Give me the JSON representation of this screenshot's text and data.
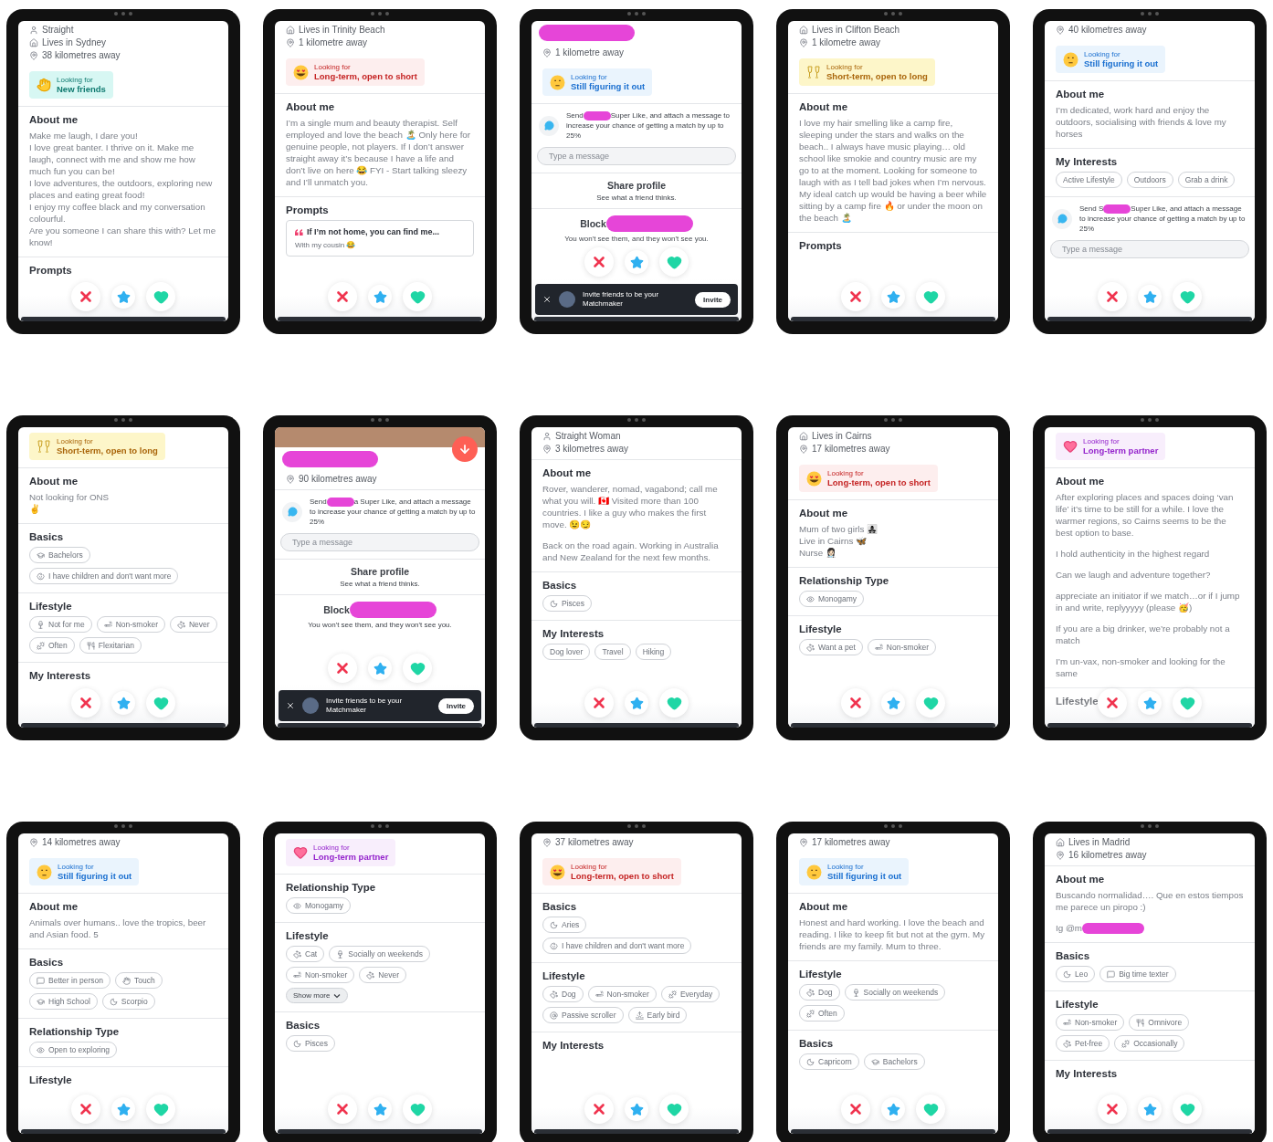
{
  "tablets": [
    {
      "blocks": [
        {
          "kind": "meta",
          "items": [
            {
              "kind": "orientation",
              "text": "Straight"
            },
            {
              "kind": "residence",
              "text": "Lives in Sydney"
            },
            {
              "kind": "distance",
              "text": "38 kilometres away"
            }
          ]
        },
        {
          "kind": "looking",
          "color": "#0f7a70",
          "label": "Looking for",
          "value": "New friends"
        },
        {
          "kind": "section",
          "title": "About me",
          "paragraphs": [
            {
              "text": "Make me laugh, I dare you!\nI love great banter. I thrive on it. Make me laugh, connect with me and show me how much fun you can be!\nI love adventures, the outdoors, exploring new places and eating great food!\nI enjoy my coffee black and my conversation colourful.\nAre you someone I can share this with? Let me know!",
              "redacted": false
            }
          ]
        },
        {
          "kind": "section",
          "title": "Prompts"
        }
      ]
    },
    {
      "blocks": [
        {
          "kind": "meta",
          "items": [
            {
              "kind": "residence",
              "text": "Lives in Trinity Beach"
            },
            {
              "kind": "distance",
              "text": "1 kilometre away"
            }
          ]
        },
        {
          "kind": "looking",
          "color": "#c52424",
          "label": "Looking for",
          "value": "Long-term, open to short"
        },
        {
          "kind": "section",
          "title": "About me",
          "paragraphs": [
            {
              "text": "I’m a single mum and beauty therapist. Self employed and love the beach 🏝️ Only here for genuine people, not players. If I don’t answer straight away it’s because I have a life and don’t live on here 😂 FYI - Start talking sleezy and I’ll unmatch you.",
              "redacted": false
            }
          ]
        },
        {
          "kind": "section",
          "title": "Prompts",
          "prompts": [
            {
              "question": "If I’m not home, you can find me...",
              "answer": "With my cousin 😂"
            }
          ]
        }
      ]
    },
    {
      "blocks": [
        {
          "kind": "hidden_name"
        },
        {
          "kind": "meta",
          "items": [
            {
              "kind": "distance",
              "text": "1 kilometre away"
            }
          ]
        },
        {
          "kind": "looking",
          "color": "#1a6fd0",
          "label": "Looking for",
          "value": "Still figuring it out"
        },
        {
          "kind": "superlike",
          "before": "Send",
          "after": "Super Like, and attach a message to increase your chance of getting a match by up to 25%"
        },
        {
          "kind": "message",
          "placeholder": "Type a message"
        },
        {
          "kind": "share",
          "title": "Share profile",
          "subtitle": "See what a friend thinks."
        },
        {
          "kind": "block",
          "title": "Block",
          "subtitle": "You won't see them, and they won't see you."
        }
      ],
      "invite": {
        "text": "Invite friends to be your Matchmaker",
        "button": "Invite"
      }
    },
    {
      "blocks": [
        {
          "kind": "meta",
          "items": [
            {
              "kind": "residence",
              "text": "Lives in Clifton Beach"
            },
            {
              "kind": "distance",
              "text": "1 kilometre away"
            }
          ]
        },
        {
          "kind": "looking",
          "color": "#a9650a",
          "label": "Looking for",
          "value": "Short-term, open to long"
        },
        {
          "kind": "section",
          "title": "About me",
          "paragraphs": [
            {
              "text": "I love my hair smelling like a camp fire, sleeping under the stars and walks on the beach.. I always have music playing… old school like smokie and country music are my go to at the moment. Looking for someone to laugh with as I tell bad jokes when I’m nervous. My ideal catch up would be having a beer while sitting by a camp fire 🔥 or under the moon on the beach 🏝️",
              "redacted": false
            }
          ]
        },
        {
          "kind": "section",
          "title": "Prompts"
        }
      ]
    },
    {
      "blocks": [
        {
          "kind": "meta",
          "items": [
            {
              "kind": "distance",
              "text": "40 kilometres away"
            }
          ]
        },
        {
          "kind": "looking",
          "color": "#1a6fd0",
          "label": "Looking for",
          "value": "Still figuring it out"
        },
        {
          "kind": "section",
          "title": "About me",
          "paragraphs": [
            {
              "text": "I’m dedicated, work hard and enjoy the outdoors, socialising with friends & love my horses",
              "redacted": false
            }
          ]
        },
        {
          "kind": "section",
          "title": "My Interests",
          "chips": [
            {
              "kind": "interest",
              "label": "Active Lifestyle"
            },
            {
              "kind": "interest",
              "label": "Outdoors"
            },
            {
              "kind": "interest",
              "label": "Grab a drink"
            }
          ]
        },
        {
          "kind": "superlike",
          "before": "Send S",
          "after": "Super Like, and attach a message to increase your chance of getting a match by up to 25%"
        },
        {
          "kind": "message",
          "placeholder": "Type a message"
        }
      ]
    },
    {
      "blocks": [
        {
          "kind": "looking",
          "color": "#a9650a",
          "label": "Looking for",
          "value": "Short-term, open to long"
        },
        {
          "kind": "section",
          "title": "About me",
          "paragraphs": [
            {
              "text": "Not looking for ONS\n✌️",
              "redacted": false
            }
          ]
        },
        {
          "kind": "section",
          "title": "Basics",
          "chips": [
            {
              "kind": "education",
              "label": "Bachelors"
            },
            {
              "kind": "family",
              "label": "I have children and don't want more"
            }
          ]
        },
        {
          "kind": "section",
          "title": "Lifestyle",
          "chips": [
            {
              "kind": "drinking",
              "label": "Not for me"
            },
            {
              "kind": "smoking",
              "label": "Non-smoker"
            },
            {
              "kind": "pets",
              "label": "Never"
            },
            {
              "kind": "workout",
              "label": "Often"
            },
            {
              "kind": "diet",
              "label": "Flexitarian"
            }
          ]
        },
        {
          "kind": "section",
          "title": "My Interests"
        }
      ]
    },
    {
      "blocks": [
        {
          "kind": "photo"
        },
        {
          "kind": "hidden_name"
        },
        {
          "kind": "meta",
          "items": [
            {
              "kind": "distance",
              "text": "90 kilometres away"
            }
          ]
        },
        {
          "kind": "superlike",
          "before": "Send",
          "after": "a Super Like, and attach a message to increase your chance of getting a match by up to 25%"
        },
        {
          "kind": "message",
          "placeholder": "Type a message"
        },
        {
          "kind": "share",
          "title": "Share profile",
          "subtitle": "See what a friend thinks."
        },
        {
          "kind": "block",
          "title": "Block",
          "subtitle": "You won't see them, and they won't see you."
        }
      ],
      "invite": {
        "text": "Invite friends to be your Matchmaker",
        "button": "Invite"
      }
    },
    {
      "blocks": [
        {
          "kind": "meta",
          "items": [
            {
              "kind": "orientation",
              "text": "Straight Woman"
            },
            {
              "kind": "distance",
              "text": "3 kilometres away"
            }
          ]
        },
        {
          "kind": "section",
          "title": "About me",
          "paragraphs": [
            {
              "text": "Rover, wanderer, nomad, vagabond; call me what you will. 🇨🇦 Visited more than 100 countries.  I like a guy who makes the first move. 😉😏",
              "redacted": false
            },
            {
              "text": "Back on the road again.  Working in Australia and New Zealand for the next few months.",
              "redacted": false
            }
          ]
        },
        {
          "kind": "section",
          "title": "Basics",
          "chips": [
            {
              "kind": "zodiac",
              "label": "Pisces"
            }
          ]
        },
        {
          "kind": "section",
          "title": "My Interests",
          "chips": [
            {
              "kind": "interest",
              "label": "Dog lover"
            },
            {
              "kind": "interest",
              "label": "Travel"
            },
            {
              "kind": "interest",
              "label": "Hiking"
            }
          ]
        }
      ]
    },
    {
      "blocks": [
        {
          "kind": "meta",
          "items": [
            {
              "kind": "residence",
              "text": "Lives in Cairns"
            },
            {
              "kind": "distance",
              "text": "17 kilometres away"
            }
          ]
        },
        {
          "kind": "looking",
          "color": "#c52424",
          "label": "Looking for",
          "value": "Long-term, open to short"
        },
        {
          "kind": "section",
          "title": "About me",
          "paragraphs": [
            {
              "text": "Mum of two girls 👩‍👧‍👧\nLive in Cairns 🦋\nNurse 👩🏻‍⚕️",
              "redacted": false
            }
          ]
        },
        {
          "kind": "section",
          "title": "Relationship Type",
          "chips": [
            {
              "kind": "relationship",
              "label": "Monogamy"
            }
          ]
        },
        {
          "kind": "section",
          "title": "Lifestyle",
          "chips": [
            {
              "kind": "pets",
              "label": "Want a pet"
            },
            {
              "kind": "smoking",
              "label": "Non-smoker"
            }
          ]
        }
      ]
    },
    {
      "blocks": [
        {
          "kind": "looking",
          "color": "#9424cc",
          "label": "Looking for",
          "value": "Long-term partner"
        },
        {
          "kind": "section",
          "title": "About me",
          "paragraphs": [
            {
              "text": "After exploring places and spaces doing ‘van life’ it’s time to be still for a while. I love the warmer regions, so Cairns seems to be the best option to base.",
              "redacted": false
            },
            {
              "text": "I hold authenticity in the highest regard",
              "redacted": false
            },
            {
              "text": "Can we laugh and adventure together?",
              "redacted": false
            },
            {
              "text": "appreciate an initiator if we match…or if I jump in and write, replyyyyy (please 🥳)",
              "redacted": false
            },
            {
              "text": "If you are a big drinker, we’re probably not a match",
              "redacted": false
            },
            {
              "text": "I’m un-vax, non-smoker and looking for the same",
              "redacted": false
            }
          ]
        },
        {
          "kind": "section",
          "title": "Lifestyle"
        }
      ]
    },
    {
      "blocks": [
        {
          "kind": "meta",
          "items": [
            {
              "kind": "distance",
              "text": "14 kilometres away"
            }
          ]
        },
        {
          "kind": "looking",
          "color": "#1a6fd0",
          "label": "Looking for",
          "value": "Still figuring it out"
        },
        {
          "kind": "section",
          "title": "About me",
          "paragraphs": [
            {
              "text": "Animals over humans.. love the tropics, beer and Asian food. 5",
              "redacted": false
            }
          ]
        },
        {
          "kind": "section",
          "title": "Basics",
          "chips": [
            {
              "kind": "communication",
              "label": "Better in person"
            },
            {
              "kind": "love_language",
              "label": "Touch"
            },
            {
              "kind": "education",
              "label": "High School"
            },
            {
              "kind": "zodiac",
              "label": "Scorpio"
            }
          ]
        },
        {
          "kind": "section",
          "title": "Relationship Type",
          "chips": [
            {
              "kind": "relationship",
              "label": "Open to exploring"
            }
          ]
        },
        {
          "kind": "section",
          "title": "Lifestyle"
        }
      ]
    },
    {
      "blocks": [
        {
          "kind": "looking",
          "color": "#9424cc",
          "label": "Looking for",
          "value": "Long-term partner"
        },
        {
          "kind": "section",
          "title": "Relationship Type",
          "chips": [
            {
              "kind": "relationship",
              "label": "Monogamy"
            }
          ]
        },
        {
          "kind": "section",
          "title": "Lifestyle",
          "chips": [
            {
              "kind": "pets",
              "label": "Cat"
            },
            {
              "kind": "drinking",
              "label": "Socially on weekends"
            },
            {
              "kind": "smoking",
              "label": "Non-smoker"
            },
            {
              "kind": "pets",
              "label": "Never"
            }
          ],
          "show_more": "Show more"
        },
        {
          "kind": "section",
          "title": "Basics",
          "chips": [
            {
              "kind": "zodiac",
              "label": "Pisces"
            }
          ]
        }
      ]
    },
    {
      "blocks": [
        {
          "kind": "meta",
          "items": [
            {
              "kind": "distance",
              "text": "37 kilometres away"
            }
          ]
        },
        {
          "kind": "looking",
          "color": "#c52424",
          "label": "Looking for",
          "value": "Long-term, open to short"
        },
        {
          "kind": "section",
          "title": "Basics",
          "chips": [
            {
              "kind": "zodiac",
              "label": "Aries"
            },
            {
              "kind": "family",
              "label": "I have children and don't want more"
            }
          ]
        },
        {
          "kind": "section",
          "title": "Lifestyle",
          "chips": [
            {
              "kind": "pets",
              "label": "Dog"
            },
            {
              "kind": "smoking",
              "label": "Non-smoker"
            },
            {
              "kind": "workout",
              "label": "Everyday"
            },
            {
              "kind": "social",
              "label": "Passive scroller"
            },
            {
              "kind": "sleep",
              "label": "Early bird"
            }
          ]
        },
        {
          "kind": "section",
          "title": "My Interests"
        }
      ]
    },
    {
      "blocks": [
        {
          "kind": "meta",
          "items": [
            {
              "kind": "distance",
              "text": "17 kilometres away"
            }
          ]
        },
        {
          "kind": "looking",
          "color": "#1a6fd0",
          "label": "Looking for",
          "value": "Still figuring it out"
        },
        {
          "kind": "section",
          "title": "About me",
          "paragraphs": [
            {
              "text": "Honest and hard working. I love the beach and reading. I like to keep fit but not at the gym. My friends are my family. Mum to three.",
              "redacted": false
            }
          ]
        },
        {
          "kind": "section",
          "title": "Lifestyle",
          "chips": [
            {
              "kind": "pets",
              "label": "Dog"
            },
            {
              "kind": "drinking",
              "label": "Socially on weekends"
            },
            {
              "kind": "workout",
              "label": "Often"
            }
          ]
        },
        {
          "kind": "section",
          "title": "Basics",
          "chips": [
            {
              "kind": "zodiac",
              "label": "Capricorn"
            },
            {
              "kind": "education",
              "label": "Bachelors"
            }
          ]
        }
      ]
    },
    {
      "blocks": [
        {
          "kind": "meta",
          "items": [
            {
              "kind": "residence",
              "text": "Lives in Madrid"
            },
            {
              "kind": "distance",
              "text": "16 kilometres away"
            }
          ]
        },
        {
          "kind": "section",
          "title": "About me",
          "paragraphs": [
            {
              "text": "Buscando normalidad…. Que en estos tiempos me parece un piropo :)",
              "redacted": false
            },
            {
              "text": "Ig @m",
              "redacted": true
            }
          ]
        },
        {
          "kind": "section",
          "title": "Basics",
          "chips": [
            {
              "kind": "zodiac",
              "label": "Leo"
            },
            {
              "kind": "communication",
              "label": "Big time texter"
            }
          ]
        },
        {
          "kind": "section",
          "title": "Lifestyle",
          "chips": [
            {
              "kind": "smoking",
              "label": "Non-smoker"
            },
            {
              "kind": "diet",
              "label": "Omnivore"
            },
            {
              "kind": "pets",
              "label": "Pet-free"
            },
            {
              "kind": "workout",
              "label": "Occasionally"
            }
          ]
        },
        {
          "kind": "section",
          "title": "My Interests"
        }
      ]
    }
  ]
}
